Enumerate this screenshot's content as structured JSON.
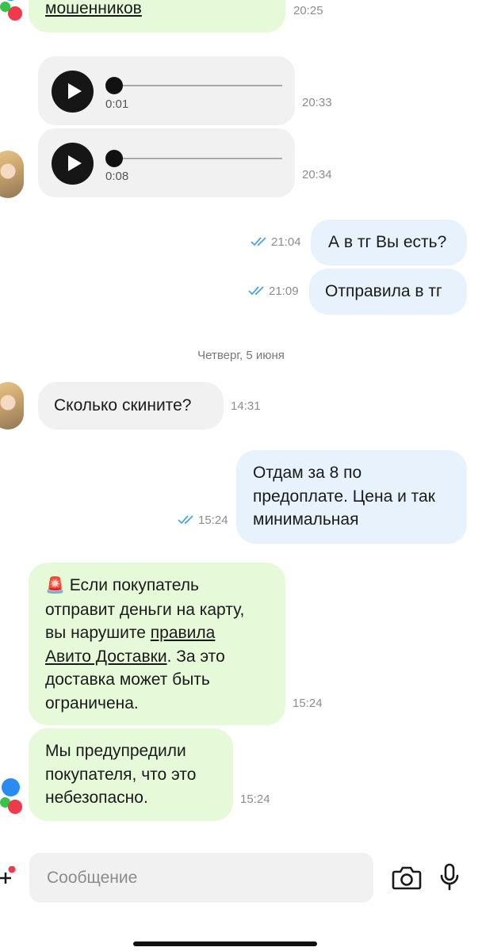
{
  "messages": {
    "m1": {
      "text": "мошенников",
      "time": "20:25"
    },
    "voice1": {
      "duration": "0:01",
      "time": "20:33",
      "progress": 0
    },
    "voice2": {
      "duration": "0:08",
      "time": "20:34",
      "progress": 0
    },
    "m2": {
      "text": "А в тг Вы есть?",
      "time": "21:04"
    },
    "m3": {
      "text": "Отправила в тг",
      "time": "21:09"
    },
    "date_separator": "Четверг, 5 июня",
    "m4": {
      "text": "Сколько скините?",
      "time": "14:31"
    },
    "m5": {
      "line1": "Отдам за 8 по",
      "line2": "предоплате. Цена и так",
      "line3": "минимальная",
      "time": "15:24"
    },
    "m6": {
      "emoji": "🚨",
      "line1": "Если покупатель",
      "line2": "отправит деньги на карту,",
      "line3_prefix": "вы нарушите ",
      "link1": "правила",
      "link2": "Авито Доставки",
      "line4_suffix": ". За это",
      "line5": "доставка может быть",
      "line6": "ограничена.",
      "time": "15:24"
    },
    "m7": {
      "line1": "Мы предупредили",
      "line2": "покупателя, что это",
      "line3": "небезопасно.",
      "time": "15:24"
    }
  },
  "composer": {
    "placeholder": "Сообщение"
  },
  "colors": {
    "system_bubble": "#e6f9d9",
    "outgoing_bubble": "#e7f2fc",
    "incoming_bubble": "#f1f1f1",
    "read_ticks": "#4aa3e8"
  },
  "icons": [
    "play-icon",
    "double-check-icon",
    "plus-icon",
    "camera-icon",
    "microphone-icon"
  ]
}
